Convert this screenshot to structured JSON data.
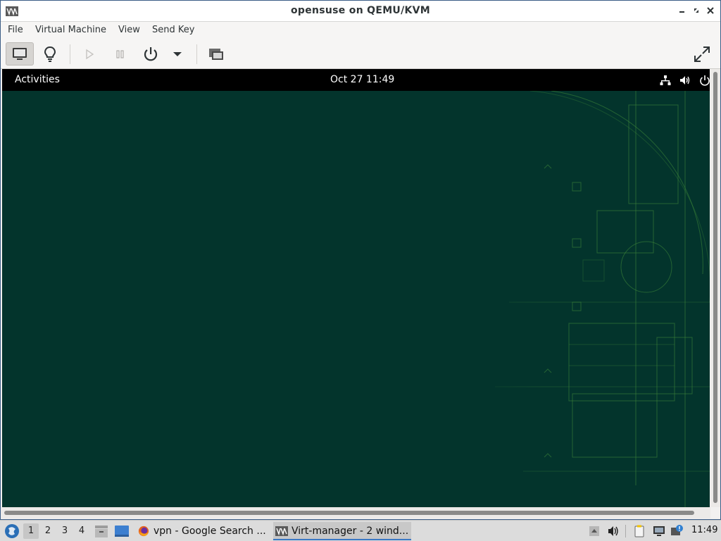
{
  "window": {
    "title": "opensuse on QEMU/KVM",
    "controls": [
      "minimize-icon",
      "restore-icon",
      "close-icon"
    ]
  },
  "menubar": {
    "items": [
      "File",
      "Virtual Machine",
      "View",
      "Send Key"
    ]
  },
  "toolbar": {
    "buttons": [
      "monitor-icon",
      "lightbulb-icon",
      "play-icon",
      "pause-icon",
      "power-icon",
      "dropdown-icon",
      "screenshot-icon",
      "fullscreen-icon"
    ]
  },
  "guest": {
    "activities": "Activities",
    "clock": "Oct 27  11:49",
    "tray": [
      "network-icon",
      "volume-icon",
      "power-icon"
    ],
    "background_color": "#03342c",
    "accent_color": "#3f8a3a"
  },
  "taskbar": {
    "workspaces": [
      "1",
      "2",
      "3",
      "4"
    ],
    "current_workspace": "1",
    "tasks": [
      {
        "label": "vpn - Google Search ...",
        "icon": "firefox-icon"
      },
      {
        "label": "Virt-manager - 2 wind...",
        "icon": "virt-manager-icon"
      }
    ],
    "clock": "11:49"
  }
}
